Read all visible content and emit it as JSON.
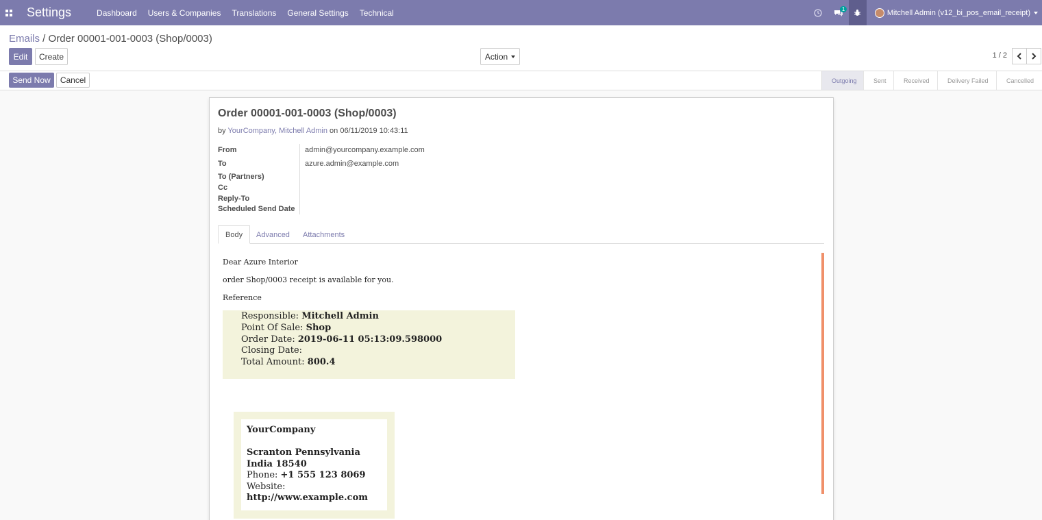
{
  "navbar": {
    "app_title": "Settings",
    "menu": [
      "Dashboard",
      "Users & Companies",
      "Translations",
      "General Settings",
      "Technical"
    ],
    "message_badge": "1",
    "user_label": "Mitchell Admin (v12_bi_pos_email_receipt)",
    "accent_color": "#7c7bad"
  },
  "control": {
    "breadcrumb_parent": "Emails",
    "breadcrumb_separator": " / ",
    "breadcrumb_current": "Order 00001-001-0003 (Shop/0003)",
    "edit_label": "Edit",
    "create_label": "Create",
    "action_label": "Action",
    "pager": "1 / 2"
  },
  "statusbar": {
    "send_now_label": "Send Now",
    "cancel_label": "Cancel",
    "stages": [
      "Outgoing",
      "Sent",
      "Received",
      "Delivery Failed",
      "Cancelled"
    ],
    "active_stage": "Outgoing"
  },
  "record": {
    "title": "Order 00001-001-0003 (Shop/0003)",
    "by_prefix": "by ",
    "authors": "YourCompany, Mitchell Admin",
    "on_text": " on ",
    "date": "06/11/2019 10:43:11",
    "fields": {
      "from_label": "From",
      "from_value": "admin@yourcompany.example.com",
      "to_label": "To",
      "to_value": "azure.admin@example.com",
      "to_partners_label": "To (Partners)",
      "cc_label": "Cc",
      "reply_to_label": "Reply-To",
      "scheduled_label": "Scheduled Send Date"
    },
    "tabs": [
      "Body",
      "Advanced",
      "Attachments"
    ],
    "body": {
      "greeting": "Dear Azure Interior",
      "line1": "order Shop/0003 receipt is available for you.",
      "reference_label": "Reference",
      "responsible_label": "Responsible: ",
      "responsible_value": "Mitchell Admin",
      "pos_label": "Point Of Sale: ",
      "pos_value": "Shop",
      "order_date_label": "Order Date: ",
      "order_date_value": "2019-06-11 05:13:09.598000",
      "closing_date_label": "Closing Date:",
      "total_label": "Total Amount: ",
      "total_value": "800.4",
      "company_name": "YourCompany",
      "company_city": "Scranton Pennsylvania",
      "company_country": "India 18540",
      "phone_label": "Phone: ",
      "phone_value": "+1 555 123 8069",
      "website_label": "Website:",
      "website_value": "http://www.example.com"
    }
  }
}
